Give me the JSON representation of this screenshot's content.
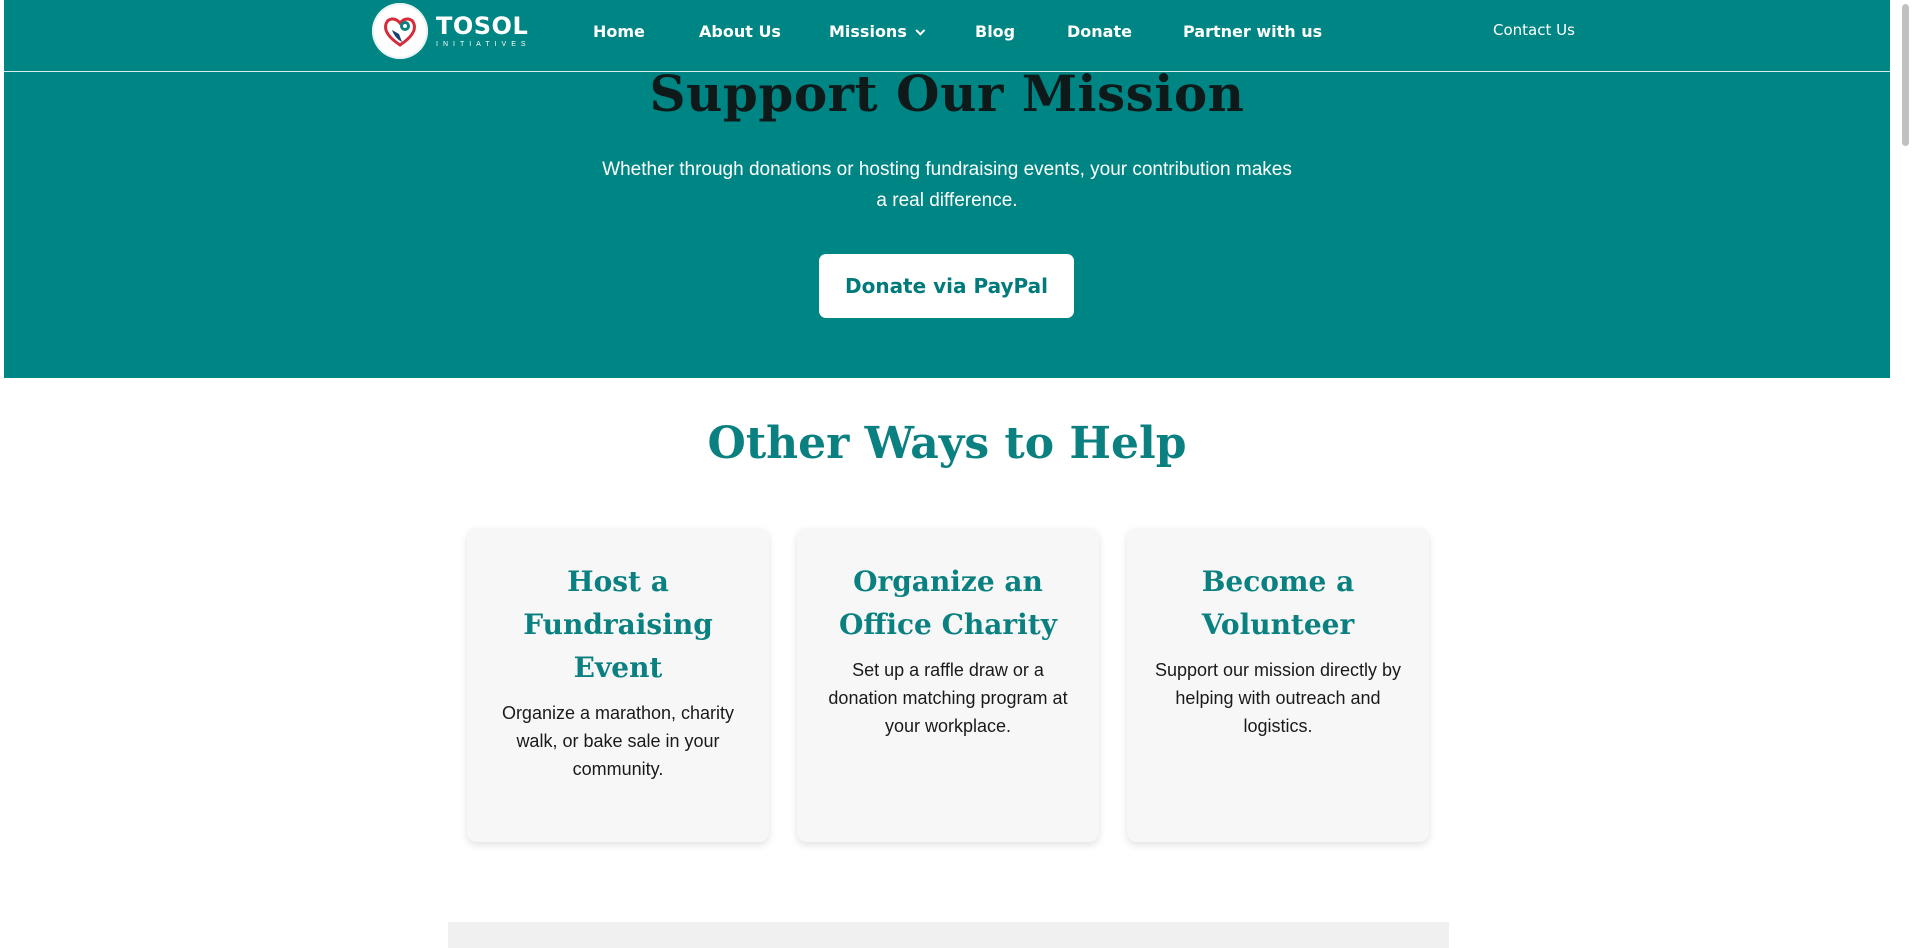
{
  "header": {
    "logo": {
      "name": "TOSOL",
      "subtitle": "INITIATIVES"
    },
    "nav": [
      {
        "label": "Home"
      },
      {
        "label": "About Us"
      },
      {
        "label": "Missions"
      },
      {
        "label": "Blog"
      },
      {
        "label": "Donate"
      },
      {
        "label": "Partner with us"
      }
    ],
    "contact_label": "Contact Us"
  },
  "hero": {
    "title": "Support Our Mission",
    "text": "Whether through donations or hosting fundraising events, your contribution makes a real difference.",
    "button_label": "Donate via PayPal"
  },
  "help": {
    "title": "Other Ways to Help",
    "cards": [
      {
        "title": "Host a Fundraising Event",
        "text": "Organize a marathon, charity walk, or bake sale in your community."
      },
      {
        "title": "Organize an Office Charity",
        "text": "Set up a raffle draw or a donation matching program at your workplace."
      },
      {
        "title": "Become a Volunteer",
        "text": "Support our mission directly by helping with outreach and logistics."
      }
    ]
  },
  "colors": {
    "brand_teal": "#008585",
    "heading_teal": "#0a8080",
    "card_bg": "#f7f7f7"
  },
  "icons": {
    "logo": "heart-hand-logo-icon",
    "missions_dropdown": "chevron-down-icon"
  }
}
